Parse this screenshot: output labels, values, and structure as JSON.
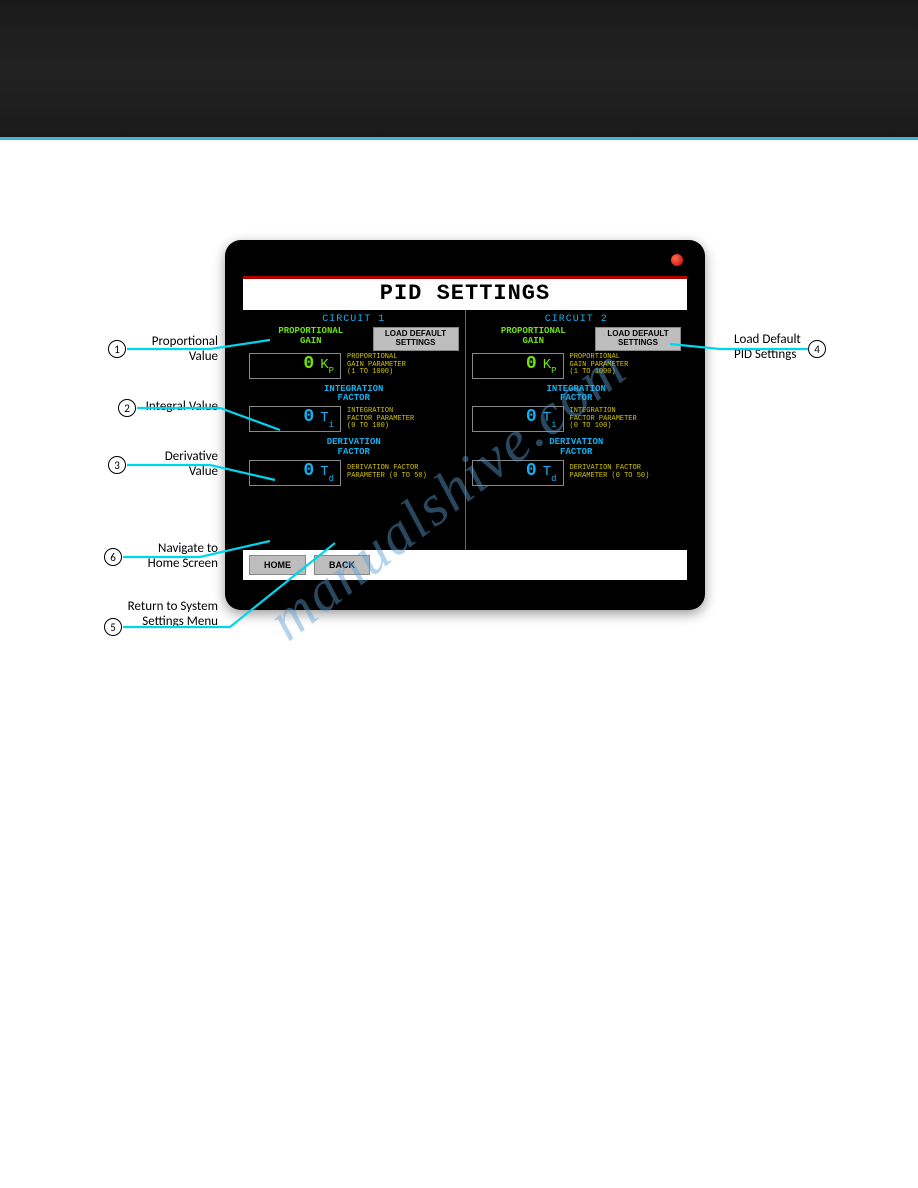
{
  "screen_title": "PID SETTINGS",
  "watermark": "manualshive.com",
  "circuits": [
    {
      "header": "CIRCUIT 1",
      "proportional": {
        "label": "PROPORTIONAL\nGAIN",
        "value": "0",
        "unit": "K",
        "sub": "P",
        "desc": "PROPORTIONAL\nGAIN PARAMETER\n(1 TO 1000)"
      },
      "integration": {
        "label": "INTEGRATION\nFACTOR",
        "value": "0",
        "unit": "T",
        "sub": "i",
        "desc": "INTEGRATION\nFACTOR PARAMETER\n(0 TO 100)"
      },
      "derivation": {
        "label": "DERIVATION\nFACTOR",
        "value": "0",
        "unit": "T",
        "sub": "d",
        "desc": "DERIVATION FACTOR\nPARAMETER (0 TO 50)"
      },
      "load_default": "LOAD DEFAULT\nSETTINGS"
    },
    {
      "header": "CIRCUIT 2",
      "proportional": {
        "label": "PROPORTIONAL\nGAIN",
        "value": "0",
        "unit": "K",
        "sub": "P",
        "desc": "PROPORTIONAL\nGAIN PARAMETER\n(1 TO 1000)"
      },
      "integration": {
        "label": "INTEGRATION\nFACTOR",
        "value": "0",
        "unit": "T",
        "sub": "i",
        "desc": "INTEGRATION\nFACTOR PARAMETER\n(0 TO 100)"
      },
      "derivation": {
        "label": "DERIVATION\nFACTOR",
        "value": "0",
        "unit": "T",
        "sub": "d",
        "desc": "DERIVATION FACTOR\nPARAMETER (0 TO 50)"
      },
      "load_default": "LOAD DEFAULT\nSETTINGS"
    }
  ],
  "nav": {
    "home": "HOME",
    "back": "BACK"
  },
  "callouts": {
    "c1": "Proportional\nValue",
    "c2": "Integral Value",
    "c3": "Derivative\nValue",
    "c4": "Load Default\nPID Settings",
    "c5": "Return to System\nSettings Menu",
    "c6": "Navigate to\nHome Screen"
  }
}
